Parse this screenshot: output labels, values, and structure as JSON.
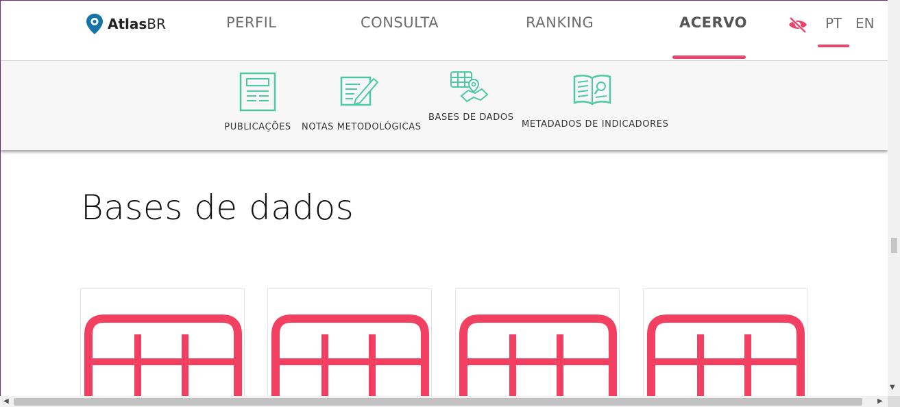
{
  "logo": {
    "brand_bold": "Atlas",
    "brand_light": "BR",
    "icon": "map-pin-icon"
  },
  "nav": {
    "items": [
      {
        "label": "PERFIL",
        "active": false
      },
      {
        "label": "CONSULTA",
        "active": false
      },
      {
        "label": "RANKING",
        "active": false
      },
      {
        "label": "ACERVO",
        "active": true
      }
    ],
    "accessibility_icon": "eye-slash-icon",
    "languages": [
      {
        "label": "PT",
        "active": true
      },
      {
        "label": "EN",
        "active": false
      }
    ],
    "accent_color": "#e8456a"
  },
  "submenu": {
    "items": [
      {
        "label": "PUBLICAÇÕES",
        "icon": "document-icon"
      },
      {
        "label": "NOTAS METODOLÓGICAS",
        "icon": "notes-pencil-icon"
      },
      {
        "label": "BASES DE DADOS",
        "icon": "table-map-icon"
      },
      {
        "label": "METADADOS DE INDICADORES",
        "icon": "book-search-icon"
      }
    ],
    "icon_color": "#4cc8a3"
  },
  "main": {
    "title": "Bases de dados",
    "cards": [
      {
        "icon": "table-icon"
      },
      {
        "icon": "table-icon"
      },
      {
        "icon": "table-icon"
      },
      {
        "icon": "table-icon"
      }
    ],
    "card_icon_color": "#f24063"
  }
}
